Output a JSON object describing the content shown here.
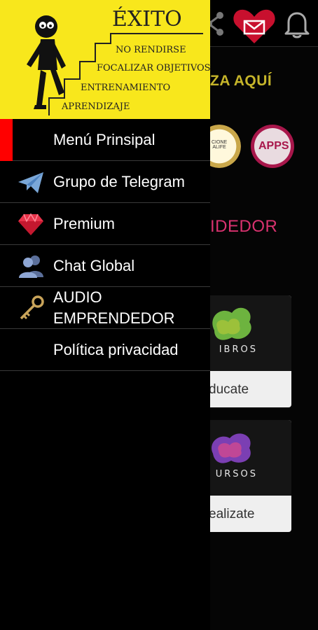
{
  "background": {
    "hero_text": "ZA AQUÍ",
    "section_text": "IDEDOR",
    "badge_right_text": "APPS",
    "badge_left_text": "CIONE\nALIFE",
    "cards": [
      {
        "thumb_label": "IBROS",
        "caption": "ducate"
      },
      {
        "thumb_label": "URSOS",
        "caption": "ealizate"
      }
    ],
    "colors": {
      "hero": "#c6b52a",
      "section": "#d9326f",
      "heart": "#c8102e"
    }
  },
  "drawer": {
    "header": {
      "title": "ÉXITO",
      "steps": [
        "NO RENDIRSE",
        "FOCALIZAR OBJETIVOS",
        "ENTRENAMIENTO",
        "APRENDIZAJE"
      ],
      "bg_color": "#f8e71c"
    },
    "menu": [
      {
        "label": "Menú Prinsipal",
        "icon": "none",
        "active": true
      },
      {
        "label": "Grupo de Telegram",
        "icon": "telegram-plane-icon"
      },
      {
        "label": "Premium",
        "icon": "ruby-gem-icon"
      },
      {
        "label": "Chat Global",
        "icon": "users-icon"
      },
      {
        "label": "AUDIO EMPRENDEDOR",
        "icon": "key-icon"
      },
      {
        "label": "Política privacidad",
        "icon": "none"
      }
    ]
  }
}
